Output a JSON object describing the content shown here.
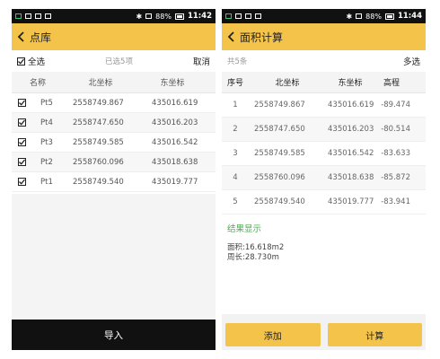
{
  "left": {
    "status": {
      "battery": "88%",
      "time": "11:42"
    },
    "title": "点库",
    "select_all": "全选",
    "selected_count": "已选5项",
    "cancel": "取消",
    "headers": {
      "name": "名称",
      "north": "北坐标",
      "east": "东坐标"
    },
    "rows": [
      {
        "name": "Pt5",
        "north": "2558749.867",
        "east": "435016.619"
      },
      {
        "name": "Pt4",
        "north": "2558747.650",
        "east": "435016.203"
      },
      {
        "name": "Pt3",
        "north": "2558749.585",
        "east": "435016.542"
      },
      {
        "name": "Pt2",
        "north": "2558760.096",
        "east": "435018.638"
      },
      {
        "name": "Pt1",
        "north": "2558749.540",
        "east": "435019.777"
      }
    ],
    "import_label": "导入"
  },
  "right": {
    "status": {
      "battery": "88%",
      "time": "11:44"
    },
    "title": "面积计算",
    "total": "共5条",
    "multi_select": "多选",
    "headers": {
      "index": "序号",
      "north": "北坐标",
      "east": "东坐标",
      "elev": "高程"
    },
    "rows": [
      {
        "index": "1",
        "north": "2558749.867",
        "east": "435016.619",
        "elev": "-89.474"
      },
      {
        "index": "2",
        "north": "2558747.650",
        "east": "435016.203",
        "elev": "-80.514"
      },
      {
        "index": "3",
        "north": "2558749.585",
        "east": "435016.542",
        "elev": "-83.633"
      },
      {
        "index": "4",
        "north": "2558760.096",
        "east": "435018.638",
        "elev": "-85.872"
      },
      {
        "index": "5",
        "north": "2558749.540",
        "east": "435019.777",
        "elev": "-83.941"
      }
    ],
    "result_title": "结果显示",
    "area": "面积:16.618m2",
    "perimeter": "周长:28.730m",
    "add_label": "添加",
    "calc_label": "计算"
  },
  "colors": {
    "accent": "#f4c34a",
    "result": "#4caf50",
    "statusbar": "#111111"
  }
}
